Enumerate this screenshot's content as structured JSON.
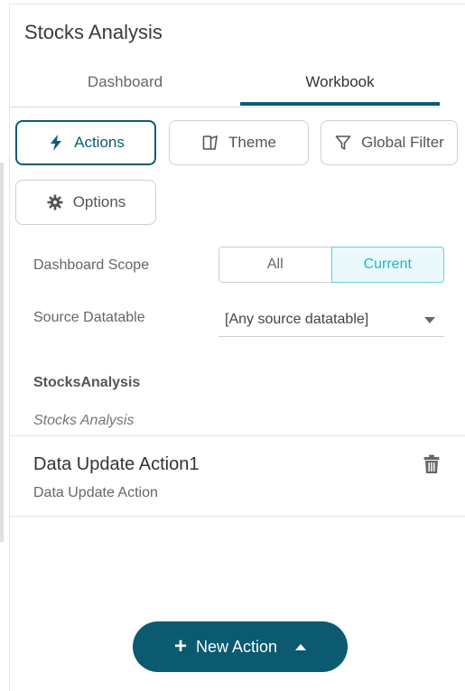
{
  "panel": {
    "title": "Stocks Analysis"
  },
  "tabs": {
    "dashboard": "Dashboard",
    "workbook": "Workbook",
    "active": "Workbook"
  },
  "toolbar": {
    "actions": {
      "label": "Actions",
      "icon": "lightning-icon"
    },
    "theme": {
      "label": "Theme",
      "icon": "theme-book-icon"
    },
    "global_filter": {
      "label": "Global Filter",
      "icon": "filter-icon"
    },
    "options": {
      "label": "Options",
      "icon": "gear-icon"
    },
    "active": "Actions"
  },
  "scope": {
    "label": "Dashboard Scope",
    "options": [
      "All",
      "Current"
    ],
    "selected": "Current"
  },
  "source": {
    "label": "Source Datatable",
    "value": "[Any source datatable]"
  },
  "group": {
    "name": "StocksAnalysis",
    "subtitle": "Stocks Analysis"
  },
  "actions_list": [
    {
      "title": "Data Update Action1",
      "type": "Data Update Action"
    }
  ],
  "new_action": {
    "label": "New Action"
  },
  "colors": {
    "accent": "#0b5c73",
    "current_bg": "#eafafc",
    "current_text": "#2bb3bd"
  }
}
